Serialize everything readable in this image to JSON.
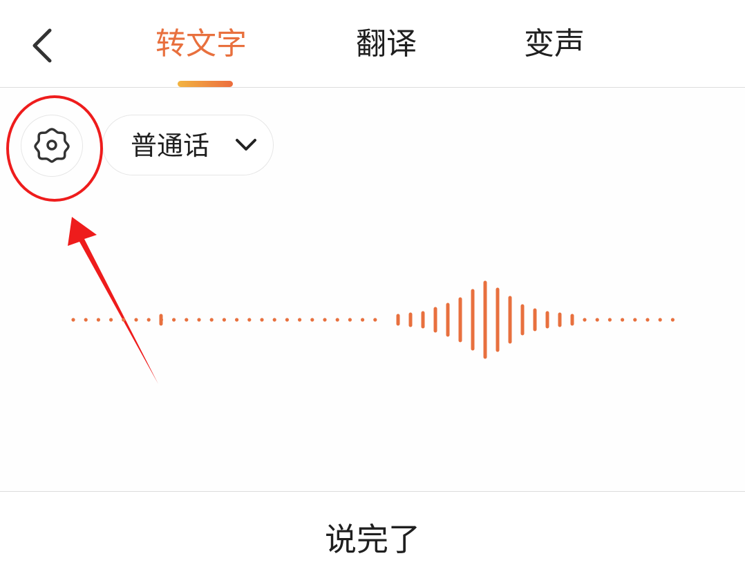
{
  "header": {
    "tabs": [
      {
        "label": "转文字",
        "active": true
      },
      {
        "label": "翻译",
        "active": false
      },
      {
        "label": "变声",
        "active": false
      }
    ]
  },
  "settings": {
    "icon": "gear-icon",
    "language_selected": "普通话"
  },
  "footer": {
    "done_label": "说完了"
  },
  "colors": {
    "accent": "#e8703e",
    "annotation": "#ee1c1c",
    "text": "#1f1f1f"
  }
}
